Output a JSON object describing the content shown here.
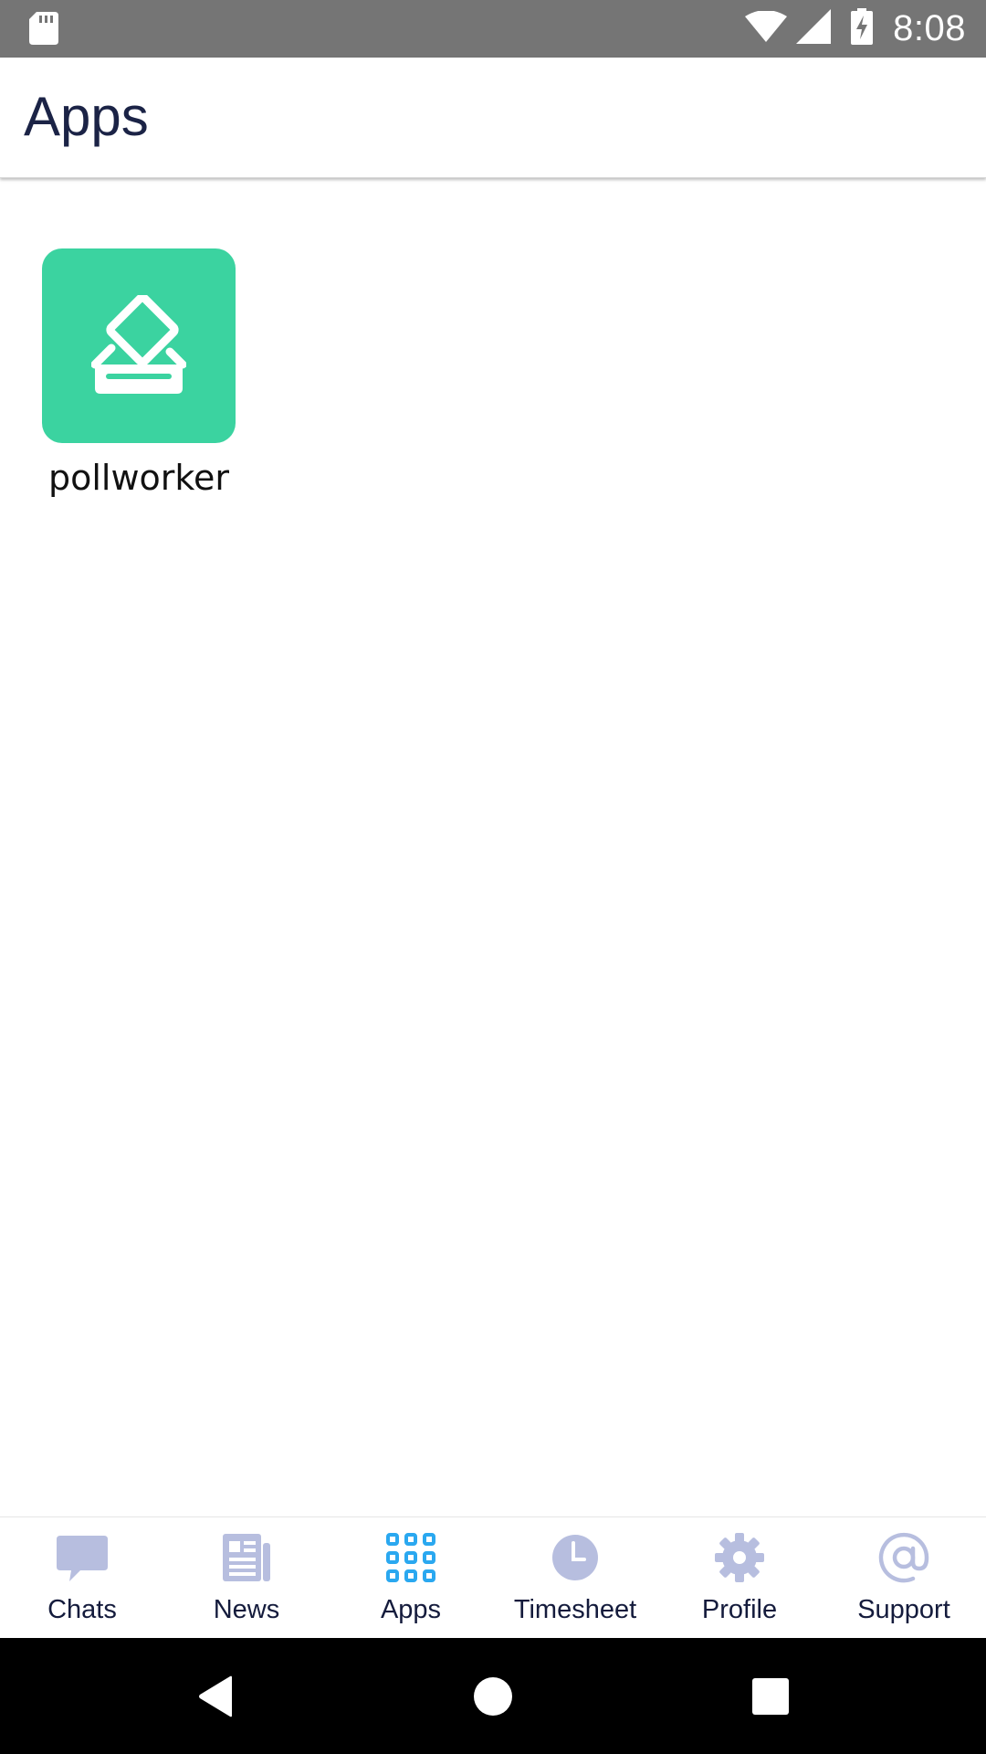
{
  "status_bar": {
    "time": "8:08",
    "icons": [
      "sd-card-icon",
      "wifi-icon",
      "signal-icon",
      "battery-charging-icon"
    ]
  },
  "app_bar": {
    "title": "Apps"
  },
  "apps": [
    {
      "label": "pollworker",
      "icon": "ballot-box-icon",
      "color": "#3bd3a0"
    }
  ],
  "bottom_nav": {
    "items": [
      {
        "label": "Chats",
        "icon": "chat-icon",
        "active": false
      },
      {
        "label": "News",
        "icon": "newspaper-icon",
        "active": false
      },
      {
        "label": "Apps",
        "icon": "apps-grid-icon",
        "active": true
      },
      {
        "label": "Timesheet",
        "icon": "clock-icon",
        "active": false
      },
      {
        "label": "Profile",
        "icon": "gear-icon",
        "active": false
      },
      {
        "label": "Support",
        "icon": "at-sign-icon",
        "active": false
      }
    ],
    "active_color": "#2aa8f0",
    "inactive_color": "#b7bedf"
  },
  "system_nav": {
    "buttons": [
      "back-icon",
      "home-icon",
      "recents-icon"
    ]
  }
}
